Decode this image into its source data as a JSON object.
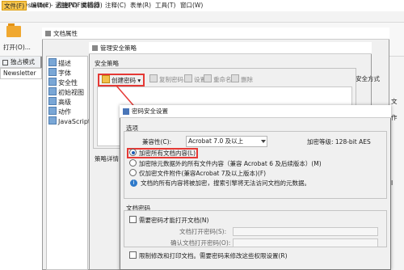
{
  "app": {
    "title": "Newsletter - 迅捷PDF编辑器",
    "icon_text": "P"
  },
  "menubar": [
    "文件(F)",
    "编辑(E)",
    "视图(V)",
    "文档(D)",
    "注释(C)",
    "表单(R)",
    "工具(T)",
    "窗口(W)"
  ],
  "toolbar": {
    "open_label": "打开(O)...",
    "mode_label": "独占模式",
    "document_tab": "Newsletter"
  },
  "docprops": {
    "title": "文档属性",
    "tree": [
      "描述",
      "字体",
      "安全性",
      "初始视图",
      "高级",
      "动作",
      "JavaScript"
    ]
  },
  "secmgr": {
    "title": "管理安全策略",
    "policy_group": "安全策略",
    "buttons": {
      "create": "创建密码",
      "copy": "复制密码",
      "settings": "设置",
      "rename": "重命名",
      "delete": "删除"
    },
    "detail_label": "策略详情",
    "right_label": "安全方式"
  },
  "pwsec": {
    "title": "密码安全设置",
    "options_label": "选项",
    "compat_label": "兼容性(C):",
    "compat_value": "Acrobat 7.0 及以上",
    "enc_level": "加密等级: 128-bit AES",
    "radio_all": "加密所有文档内容(L)",
    "radio_except_meta": "加密除元数据外的所有文件内容（兼容 Acrobat 6 及后续版本）(M)",
    "radio_attachments": "仅加密文件附件(兼容Acrobat 7及以上版本)(F)",
    "info_text": "文档的所有内容将被加密，搜索引擎将无法访问文档的元数据。",
    "docpw_label": "文档密码",
    "require_open_pw": "需要密码才能打开文档(N)",
    "open_pw_label": "文档打开密码(S):",
    "confirm_pw_label": "确认文档打开密码(O):",
    "perm_label": "限制修改和打印文档。需要密码来修改这些权限设置(R)"
  },
  "right_strip": {
    "chars": [
      "文",
      "作",
      "I"
    ]
  }
}
